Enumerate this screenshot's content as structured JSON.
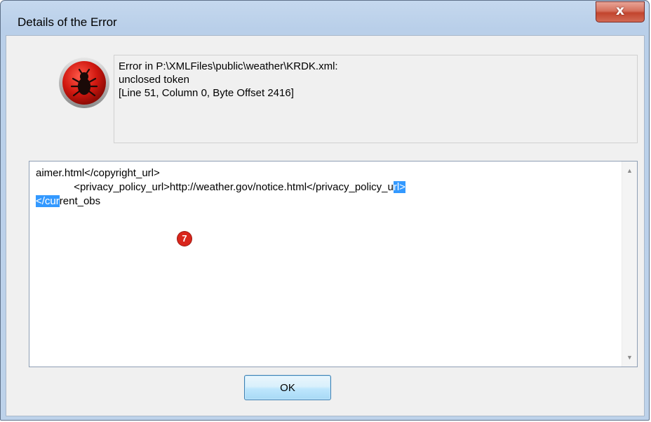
{
  "window": {
    "title": "Details of the Error",
    "close_label": "x"
  },
  "icon": {
    "name": "bug-icon"
  },
  "message": {
    "line1": "Error in P:\\XMLFiles\\public\\weather\\KRDK.xml:",
    "line2": "unclosed token",
    "line3": "[Line 51, Column 0, Byte Offset 2416]"
  },
  "details": {
    "line1": "aimer.html</copyright_url>",
    "line2_indent": "             ",
    "line2_text": "<privacy_policy_url>http://weather.gov/notice.html</privacy_policy_u",
    "line2_selected": "rl>",
    "line3_selected": "</cur",
    "line3_rest": "rent_obs"
  },
  "scrollbar": {
    "up_icon": "scroll-up-arrow-icon",
    "down_icon": "scroll-down-arrow-icon"
  },
  "badge": {
    "label": "7",
    "color": "#d9261c"
  },
  "buttons": {
    "ok_label": "OK"
  },
  "colors": {
    "selection": "#3399ff",
    "close_button": "#c2452e",
    "frame": "#bdd2ea"
  }
}
